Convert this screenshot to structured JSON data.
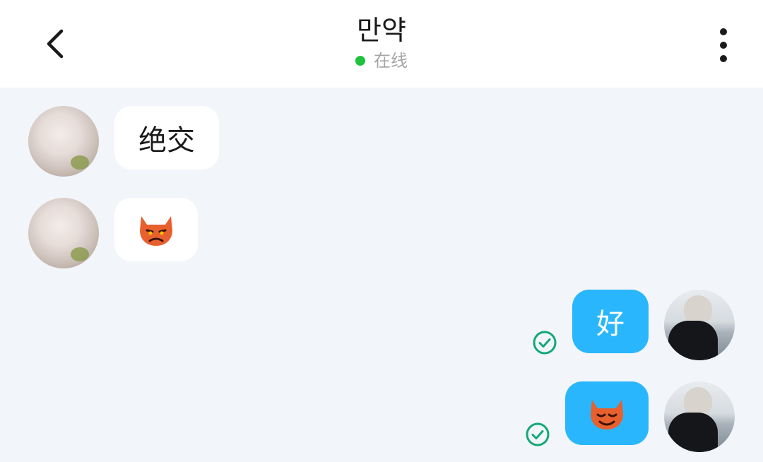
{
  "header": {
    "title": "만약",
    "status": "在线",
    "status_color": "#1fc23a",
    "back_icon": "chevron-left-icon",
    "more_icon": "vertical-dots-icon"
  },
  "messages": [
    {
      "direction": "incoming",
      "type": "text",
      "text": "绝交"
    },
    {
      "direction": "incoming",
      "type": "emoji",
      "emoji": "devil-face-icon"
    },
    {
      "direction": "outgoing",
      "type": "text",
      "text": "好",
      "read": true
    },
    {
      "direction": "outgoing",
      "type": "emoji",
      "emoji": "devil-face-icon",
      "read": true
    }
  ],
  "colors": {
    "outgoing_bubble": "#29b6fd",
    "incoming_bubble": "#ffffff",
    "background": "#f2f5f9",
    "read_check": "#14a876",
    "emoji": "#e8602e"
  }
}
